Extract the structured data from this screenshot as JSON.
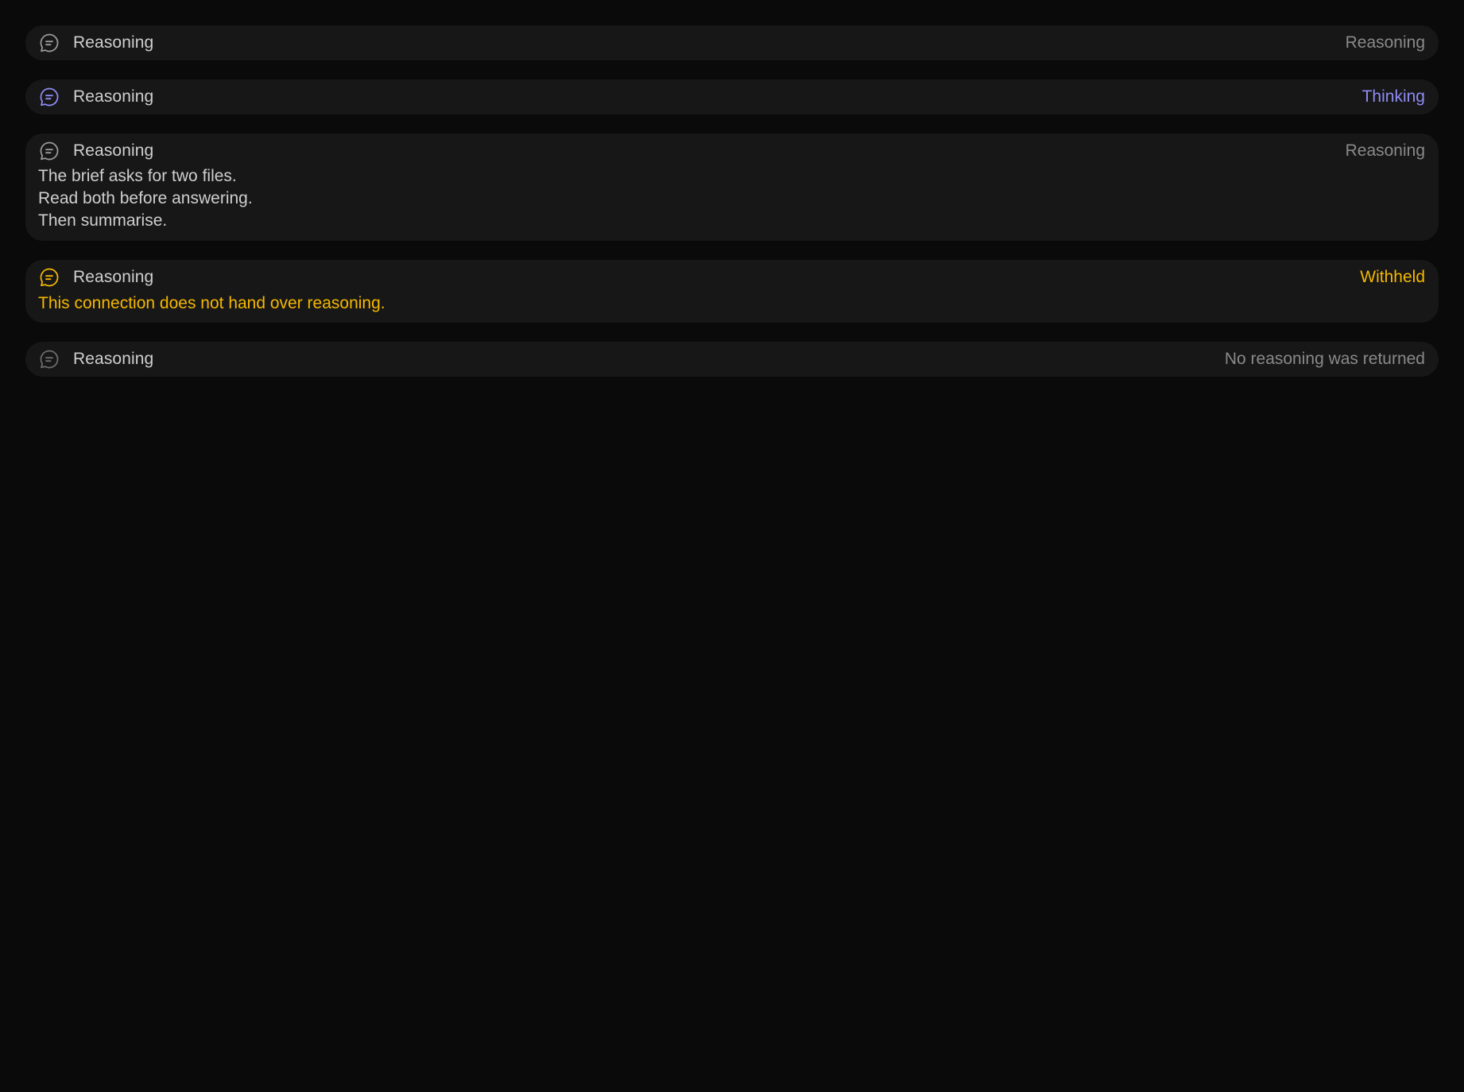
{
  "colors": {
    "background": "#0a0a0a",
    "card": "#171717",
    "text": "#cfcfcf",
    "muted": "#8a8a8a",
    "thinking": "#8f8cf4",
    "withheld": "#f5b800"
  },
  "items": [
    {
      "icon": "chat-bubble-icon",
      "title": "Reasoning",
      "status": "Reasoning"
    },
    {
      "icon": "chat-bubble-icon",
      "title": "Reasoning",
      "status": "Thinking"
    },
    {
      "icon": "chat-bubble-icon",
      "title": "Reasoning",
      "status": "Reasoning",
      "lines": [
        "The brief asks for two files.",
        "Read both before answering.",
        "Then summarise."
      ]
    },
    {
      "icon": "chat-bubble-icon",
      "title": "Reasoning",
      "status": "Withheld",
      "message": "This connection does not hand over reasoning."
    },
    {
      "icon": "chat-bubble-icon",
      "title": "Reasoning",
      "status": "No reasoning was returned"
    }
  ]
}
